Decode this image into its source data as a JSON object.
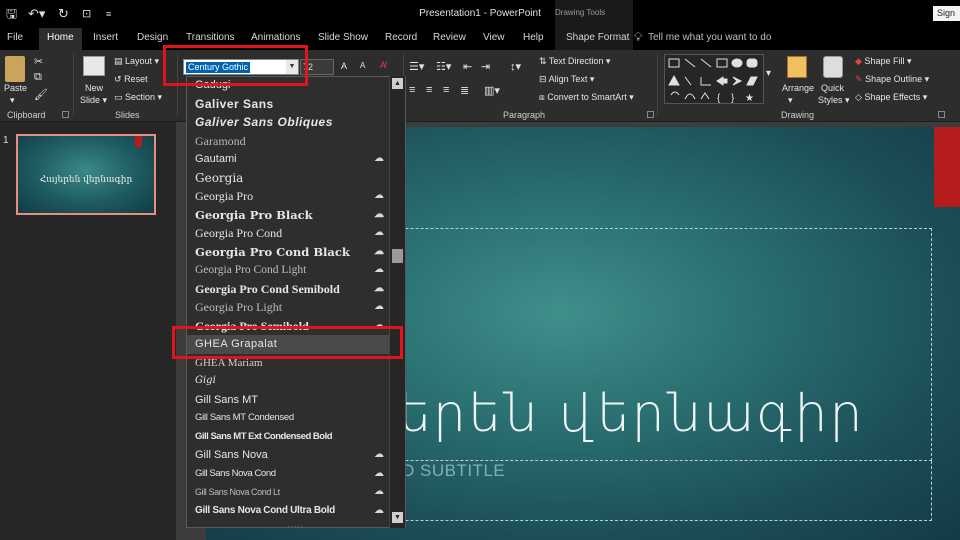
{
  "titlebar": {
    "app_title": "Presentation1  -  PowerPoint",
    "context_label": "Drawing Tools",
    "sign_in": "Sign"
  },
  "tabs": [
    {
      "label": "File"
    },
    {
      "label": "Home"
    },
    {
      "label": "Insert"
    },
    {
      "label": "Design"
    },
    {
      "label": "Transitions"
    },
    {
      "label": "Animations"
    },
    {
      "label": "Slide Show"
    },
    {
      "label": "Record"
    },
    {
      "label": "Review"
    },
    {
      "label": "View"
    },
    {
      "label": "Help"
    },
    {
      "label": "Shape Format"
    }
  ],
  "tell_me": "Tell me what you want to do",
  "ribbon": {
    "clipboard": {
      "paste": "Paste",
      "group": "Clipboard"
    },
    "slides": {
      "new_slide": "New",
      "new_slide2": "Slide ▾",
      "layout": "Layout ▾",
      "reset": "Reset",
      "section": "Section ▾",
      "group": "Slides"
    },
    "font": {
      "name": "Century Gothic",
      "size": "72"
    },
    "paragraph": {
      "text_direction": "Text Direction ▾",
      "align_text": "Align Text ▾",
      "convert_smartart": "Convert to SmartArt ▾",
      "group": "Paragraph"
    },
    "drawing": {
      "arrange": "Arrange",
      "quick_styles": "Quick",
      "quick_styles2": "Styles ▾",
      "shape_fill": "Shape Fill ▾",
      "shape_outline": "Shape Outline ▾",
      "shape_effects": "Shape Effects ▾",
      "group": "Drawing"
    }
  },
  "thumbnail": {
    "number": "1",
    "title": "Հայերեն վերնագիր"
  },
  "slide": {
    "title": "երեն վերնագիր",
    "subtitle": "D SUBTITLE"
  },
  "font_list": [
    {
      "name": "Gadugi",
      "cloud": false
    },
    {
      "name": "Galiver Sans",
      "cloud": false
    },
    {
      "name": "Galiver Sans Obliques",
      "cloud": false
    },
    {
      "name": "Garamond",
      "cloud": false
    },
    {
      "name": "Gautami",
      "cloud": true
    },
    {
      "name": "Georgia",
      "cloud": false
    },
    {
      "name": "Georgia Pro",
      "cloud": true
    },
    {
      "name": "Georgia Pro Black",
      "cloud": true
    },
    {
      "name": "Georgia Pro Cond",
      "cloud": true
    },
    {
      "name": "Georgia Pro Cond Black",
      "cloud": true
    },
    {
      "name": "Georgia Pro Cond Light",
      "cloud": true
    },
    {
      "name": "Georgia Pro Cond Semibold",
      "cloud": true
    },
    {
      "name": "Georgia Pro Light",
      "cloud": true
    },
    {
      "name": "Georgia Pro Semibold",
      "cloud": true
    },
    {
      "name": "GHEA Grapalat",
      "cloud": false,
      "selected": true
    },
    {
      "name": "GHEA Mariam",
      "cloud": false
    },
    {
      "name": "Gigi",
      "cloud": false
    },
    {
      "name": "Gill Sans MT",
      "cloud": false
    },
    {
      "name": "Gill Sans MT Condensed",
      "cloud": false
    },
    {
      "name": "Gill Sans MT Ext Condensed Bold",
      "cloud": false
    },
    {
      "name": "Gill Sans Nova",
      "cloud": true
    },
    {
      "name": "Gill Sans Nova Cond",
      "cloud": true
    },
    {
      "name": "Gill Sans Nova Cond Lt",
      "cloud": true
    },
    {
      "name": "Gill Sans Nova Cond Ultra Bold",
      "cloud": true
    }
  ],
  "colors": {
    "accent_red": "#e0141e",
    "slide_teal": "#2a6f71",
    "selection_blue": "#0063b1"
  }
}
